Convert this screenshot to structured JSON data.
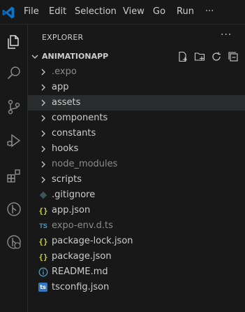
{
  "titlebar": {
    "menu": [
      "File",
      "Edit",
      "Selection",
      "View",
      "Go",
      "Run"
    ],
    "more": "···"
  },
  "activity_bar": {
    "items": [
      "files-icon",
      "search-icon",
      "source-control-icon",
      "run-debug-icon",
      "extensions-icon",
      "remote-explorer-icon",
      "test-icon"
    ]
  },
  "sidebar": {
    "title": "EXPLORER",
    "more": "···",
    "section": {
      "title": "ANIMATIONAPP",
      "actions": [
        "new-file-icon",
        "new-folder-icon",
        "refresh-icon",
        "collapse-all-icon"
      ]
    },
    "tree": [
      {
        "label": ".expo",
        "kind": "folder",
        "dim": true
      },
      {
        "label": "app",
        "kind": "folder"
      },
      {
        "label": "assets",
        "kind": "folder",
        "selected": true
      },
      {
        "label": "components",
        "kind": "folder"
      },
      {
        "label": "constants",
        "kind": "folder"
      },
      {
        "label": "hooks",
        "kind": "folder"
      },
      {
        "label": "node_modules",
        "kind": "folder",
        "dim": true
      },
      {
        "label": "scripts",
        "kind": "folder"
      },
      {
        "label": ".gitignore",
        "kind": "git"
      },
      {
        "label": "app.json",
        "kind": "json"
      },
      {
        "label": "expo-env.d.ts",
        "kind": "ts",
        "dim": true
      },
      {
        "label": "package-lock.json",
        "kind": "json"
      },
      {
        "label": "package.json",
        "kind": "json"
      },
      {
        "label": "README.md",
        "kind": "info"
      },
      {
        "label": "tsconfig.json",
        "kind": "tsbox"
      }
    ]
  },
  "colors": {
    "background": "#181818",
    "text": "#cccccc",
    "dim_text": "#8b8b8b",
    "selected_row": "#2a2d2e",
    "vscode_blue": "#0078d4",
    "json_yellow": "#cbcb41",
    "ts_blue": "#519aba",
    "tsconfig_blue": "#3178c6",
    "info_blue": "#519aba"
  }
}
